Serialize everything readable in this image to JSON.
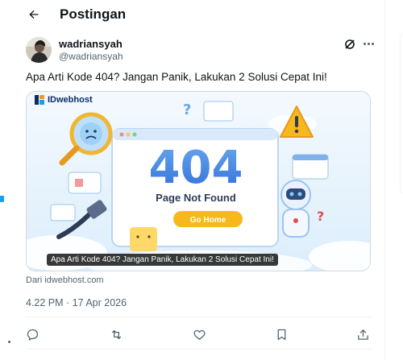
{
  "header": {
    "back_icon": "arrow-left-icon",
    "title": "Postingan"
  },
  "tweet": {
    "author": {
      "display_name": "wadriansyah",
      "handle": "@wadriansyah",
      "avatar_icon": "user-avatar"
    },
    "grok_icon": "grok-icon",
    "more_icon": "more-horizontal-icon",
    "text": "Apa Arti Kode 404? Jangan Panik, Lakukan 2 Solusi Cepat Ini!",
    "card": {
      "brand": "IDwebhost",
      "headline": "404",
      "subtitle": "Page Not Found",
      "button_label": "Go Home",
      "caption": "Apa Arti Kode 404? Jangan Panik, Lakukan 2 Solusi Cepat Ini!",
      "domain": "Dari idwebhost.com"
    },
    "timestamp": "4.22 PM · 17 Apr 2026",
    "actions": [
      {
        "name": "reply-icon"
      },
      {
        "name": "repost-icon"
      },
      {
        "name": "like-icon"
      },
      {
        "name": "bookmark-icon"
      },
      {
        "name": "share-icon"
      }
    ]
  },
  "colors": {
    "accent": "#1d9bf0",
    "text_primary": "#0f1419",
    "text_secondary": "#536471",
    "border": "#cfd9de",
    "headline_blue": "#2f6fd6",
    "button_yellow": "#f6b81c"
  }
}
